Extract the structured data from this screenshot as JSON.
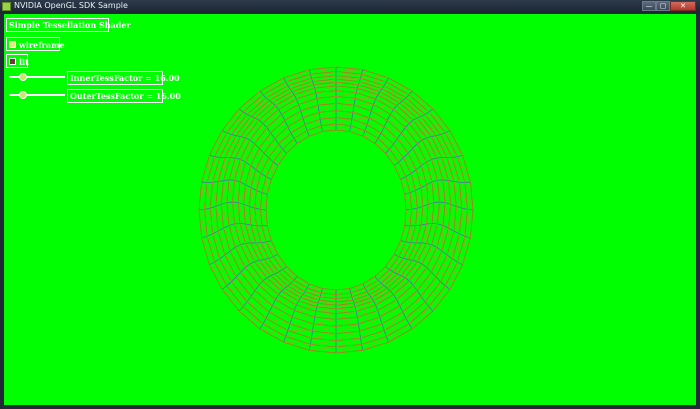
{
  "window": {
    "title": "NVIDIA OpenGL SDK Sample",
    "controls": {
      "minimize": "—",
      "maximize": "▢",
      "close": "✕"
    }
  },
  "viewport": {
    "background": "#00ff00"
  },
  "panel": {
    "title": "Simple Tessellation Shader",
    "wireframe": {
      "label": "wireframe",
      "checked": true
    },
    "lit": {
      "label": "lit",
      "checked": false
    },
    "inner_slider": {
      "label": "InnerTessFactor = 16.00",
      "value": 16.0
    },
    "outer_slider": {
      "label": "OuterTessFactor = 16.00",
      "value": 16.0
    }
  },
  "mesh": {
    "shape": "torus",
    "render_mode": "wireframe",
    "colors": {
      "primary": "#d65a2a",
      "secondary": "#5a4ad6",
      "tertiary": "#c88f2a"
    }
  }
}
